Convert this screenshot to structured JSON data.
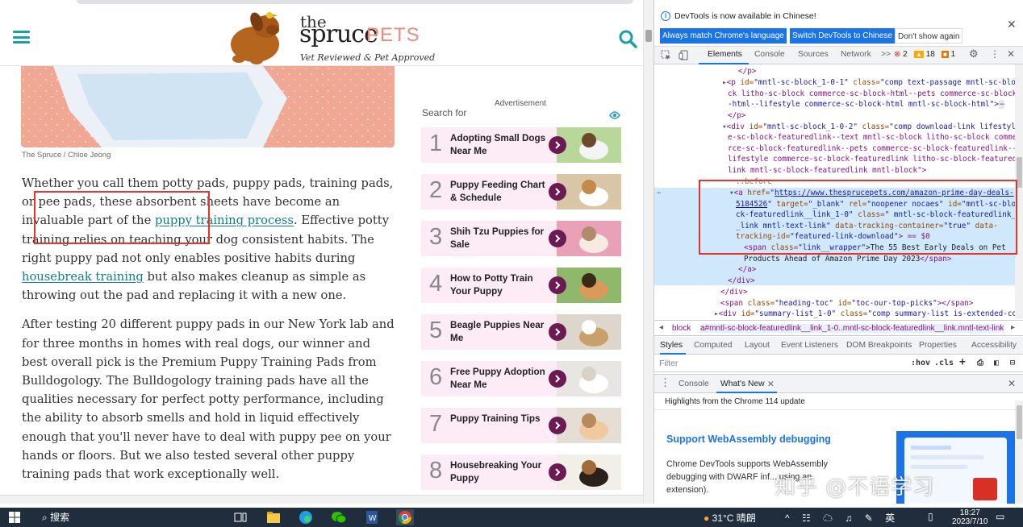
{
  "website": {
    "logo_the": "the",
    "logo_spruce": "spruce",
    "logo_pets": "PETS",
    "logo_tagline": "Vet Reviewed & Pet Approved",
    "photo_caption": "The Spruce / Chloe Jeong",
    "article": {
      "p1_a": "Whether you call them potty pads, puppy pads, training pads, or pee pads, these absorbent sheets have become an invaluable part of the ",
      "p1_link1": "puppy training process",
      "p1_b": ". Effective potty training relies on teaching your dog consistent habits. The right puppy pad not only enables positive habits during ",
      "p1_link2": "housebreak training",
      "p1_c": " but also makes cleanup as simple as throwing out the pad and replacing it with a new one.",
      "p2": "After testing 20 different puppy pads in our New York lab and for three months in homes with real dogs, our winner and best overall pick is the Premium Puppy Training Pads from Bulldogology. The Bulldogology training pads have all the qualities necessary for perfect potty performance, including the ability to absorb smells and hold in liquid effectively enough that you'll never have to deal with puppy pee on your hands or floors. But we also tested several other puppy training pads that work exceptionally well."
    },
    "sidebar": {
      "ad_label": "Advertisement",
      "search_for": "Search for",
      "items": [
        {
          "num": "1",
          "label": "Adopting Small Dogs Near Me"
        },
        {
          "num": "2",
          "label": "Puppy Feeding Chart & Schedule"
        },
        {
          "num": "3",
          "label": "Shih Tzu Puppies for Sale"
        },
        {
          "num": "4",
          "label": "How to Potty Train Your Puppy"
        },
        {
          "num": "5",
          "label": "Beagle Puppies Near Me"
        },
        {
          "num": "6",
          "label": "Free Puppy Adoption Near Me"
        },
        {
          "num": "7",
          "label": "Puppy Training Tips"
        },
        {
          "num": "8",
          "label": "Housebreaking Your Puppy"
        }
      ]
    }
  },
  "devtools": {
    "notice": "DevTools is now available in Chinese!",
    "btn_match": "Always match Chrome's language",
    "btn_switch": "Switch DevTools to Chinese",
    "btn_dont": "Don't show again",
    "tabs": [
      "Elements",
      "Console",
      "Sources",
      "Network"
    ],
    "more_tabs": ">>",
    "errors": "2",
    "warnings": "18",
    "issues": "1",
    "dom": {
      "l1": "</p>",
      "l2_tag": "<p ",
      "l2_a": "id=",
      "l2_v": "\"mntl-sc-block_1-0-1\"",
      "l2_b": " class=",
      "l2_c": "\"comp text-passage mntl-sc-blo",
      "l3": "ck litho-sc-block commerce-sc-block-html--pets commerce-sc-block",
      "l4": "-html--lifestyle commerce-sc-block-html mntl-sc-block-html\">",
      "l4_more": "⋯",
      "l5": "</p>",
      "l6_tag": "<div ",
      "l6_a": "id=",
      "l6_v": "\"mntl-sc-block_1-0-2\"",
      "l6_b": " class=",
      "l6_c": "\"comp download-link lifestyl",
      "l7": "e-sc-block-featuredlink--text mntl-sc-block litho-sc-block comme",
      "l8": "rce-sc-block-featuredlink--pets commerce-sc-block-featuredlink--",
      "l9": "lifestyle commerce-sc-block-featuredlink litho-sc-block-featured",
      "l10": "link mntl-sc-block-featuredlink mntl-block\">",
      "l11": "::before",
      "l12_tag": "<a ",
      "l12_a": "href=",
      "l12_link": "https://www.thesprucepets.com/amazon-prime-day-deals-",
      "l13_link": "5184526",
      "l13_b": " target=",
      "l13_v": "\"_blank\"",
      "l13_c": " rel=",
      "l13_v2": "\"noopener nocaes\"",
      "l13_d": " id=",
      "l13_v3": "\"mntl-sc-blo",
      "l14": "ck-featuredlink__link_1-0\"",
      "l14_b": " class=",
      "l14_v": "\" mntl-sc-block-featuredlink_",
      "l15": "_link mntl-text-link\"",
      "l15_b": " data-tracking-container=",
      "l15_v": "\"true\"",
      "l15_c": " data-",
      "l16": "tracking-id=",
      "l16_v": "\"featured-link-download\"",
      "l16_b": "> == $0",
      "l17_tag": "<span ",
      "l17_a": "class=",
      "l17_v": "\"link__wrapper\"",
      "l17_t": ">The 55 Best Early Deals on Pet",
      "l18": "Products Ahead of Amazon Prime Day 2023",
      "l18_b": "</span>",
      "l19": "</a>",
      "l20": "</div>",
      "l21": "</div>",
      "l22_tag": "<span ",
      "l22_a": "class=",
      "l22_v": "\"heading-toc\"",
      "l22_b": " id=",
      "l22_v2": "\"toc-our-top-picks\"",
      "l22_c": "></span>",
      "l23_tag": "<div ",
      "l23_a": "id=",
      "l23_v": "\"summary-list_1-0\"",
      "l23_b": " class=",
      "l23_c": "\"comp summary-list is-extended-co"
    },
    "crumb_1": "block",
    "crumb_2": "a#mntl-sc-block-featuredlink__link_1-0..mntl-sc-block-featuredlink__link.mntl-text-link",
    "subtabs": [
      "Styles",
      "Computed",
      "Layout",
      "Event Listeners",
      "DOM Breakpoints",
      "Properties",
      "Accessibility"
    ],
    "filter_placeholder": "Filter",
    "hov": ":hov",
    "cls": ".cls",
    "drawer_tabs": [
      "Console",
      "What's New"
    ],
    "highlights": "Highlights from the Chrome 114 update",
    "wn_title": "Support WebAssembly debugging",
    "wn_body": "Chrome DevTools supports WebAssembly debugging with DWARF inf... using an extension)."
  },
  "watermark": "知乎 @不语学习",
  "taskbar": {
    "search": "搜索",
    "weather": "31°C 晴朗",
    "lang": "英",
    "time": "18:27",
    "date": "2023/7/10"
  },
  "colors": {
    "accent_teal": "#18a1a6",
    "link_teal": "#0f7f86",
    "annotation_red": "#e8322d",
    "card_bg": "#fdecf6",
    "devtools_blue": "#1a73e8"
  }
}
